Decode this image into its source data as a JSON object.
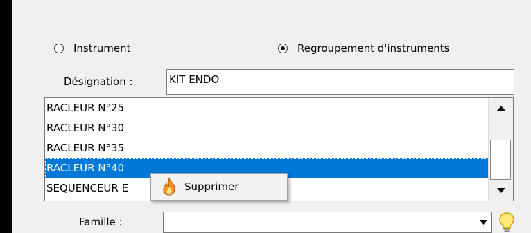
{
  "mode": {
    "option_instrument": "Instrument",
    "option_group": "Regroupement d'instruments",
    "selected": "group"
  },
  "designation": {
    "label": "Désignation :",
    "value": "KIT ENDO"
  },
  "list": {
    "items": [
      "RACLEUR N°25",
      "RACLEUR N°30",
      "RACLEUR N°35",
      "RACLEUR N°40",
      "SEQUENCEUR E"
    ],
    "selected_index": 3
  },
  "context_menu": {
    "items": [
      {
        "label": "Supprimer",
        "icon": "flame-icon"
      }
    ]
  },
  "famille": {
    "label": "Famille :",
    "value": ""
  },
  "colors": {
    "selection": "#0078d7",
    "panel": "#f0f0f0",
    "bulb": "#f2c200"
  }
}
